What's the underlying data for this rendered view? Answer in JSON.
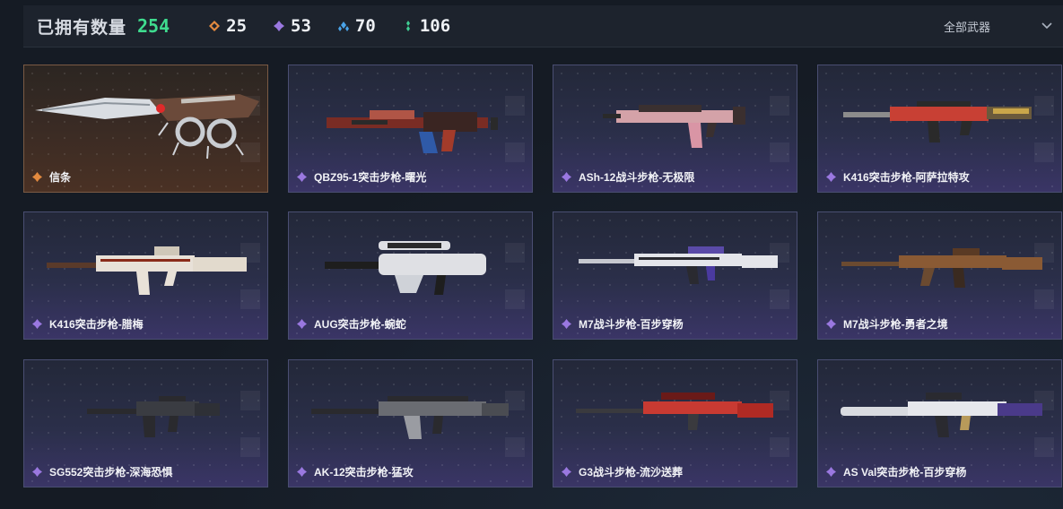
{
  "header": {
    "owned_label": "已拥有数量",
    "owned_count": "254",
    "stats": [
      {
        "icon": "orange-diamond-icon",
        "color": "#e38a3f",
        "value": "25"
      },
      {
        "icon": "purple-diamond-icon",
        "color": "#9a78e0",
        "value": "53"
      },
      {
        "icon": "blue-diamond-icon",
        "color": "#4aa3e8",
        "value": "70"
      },
      {
        "icon": "green-diamond-icon",
        "color": "#3fcf94",
        "value": "106"
      }
    ],
    "filter_label": "全部武器"
  },
  "colors": {
    "owned_count": "#3fdc8f",
    "rarity_gold": "#e38a3f",
    "rarity_purple": "#9a78e0"
  },
  "cards": [
    {
      "name": "信条",
      "rarity": "gold"
    },
    {
      "name": "QBZ95-1突击步枪-曙光",
      "rarity": "purple"
    },
    {
      "name": "ASh-12战斗步枪-无极限",
      "rarity": "purple"
    },
    {
      "name": "K416突击步枪-阿萨拉特攻",
      "rarity": "purple"
    },
    {
      "name": "K416突击步枪-腊梅",
      "rarity": "purple"
    },
    {
      "name": "AUG突击步枪-蜿蛇",
      "rarity": "purple"
    },
    {
      "name": "M7战斗步枪-百步穿杨",
      "rarity": "purple"
    },
    {
      "name": "M7战斗步枪-勇者之境",
      "rarity": "purple"
    },
    {
      "name": "SG552突击步枪-深海恐惧",
      "rarity": "purple"
    },
    {
      "name": "AK-12突击步枪-猛攻",
      "rarity": "purple"
    },
    {
      "name": "G3战斗步枪-流沙送葬",
      "rarity": "purple"
    },
    {
      "name": "AS Val突击步枪-百步穿杨",
      "rarity": "purple"
    }
  ]
}
